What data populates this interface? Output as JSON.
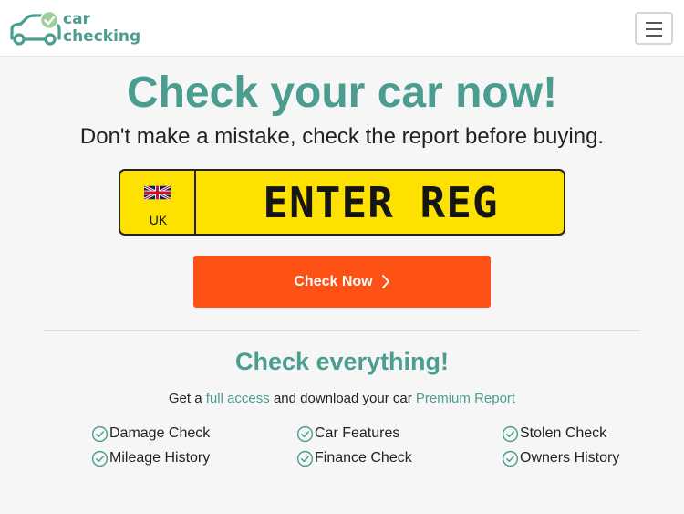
{
  "header": {
    "logo_line1": "car",
    "logo_line2": "checking",
    "menu_icon": "hamburger-icon"
  },
  "hero": {
    "title": "Check your car now!",
    "subtitle": "Don't make a mistake, check the report before buying."
  },
  "plate": {
    "country": "UK",
    "flag_icon": "uk-flag-icon",
    "placeholder": "ENTER REG",
    "value": ""
  },
  "cta": {
    "label": "Check Now",
    "icon": "chevron-right-icon"
  },
  "section": {
    "title": "Check everything!",
    "text_before": "Get a",
    "link1": "full access",
    "text_middle": "and download your car",
    "link2": "Premium Report"
  },
  "features": [
    "Damage Check",
    "Car Features",
    "Stolen Check",
    "Mileage History",
    "Finance Check",
    "Owners History"
  ],
  "colors": {
    "brand_teal": "#4a9d8f",
    "plate_yellow": "#fde100",
    "cta_orange": "#fd5115"
  }
}
